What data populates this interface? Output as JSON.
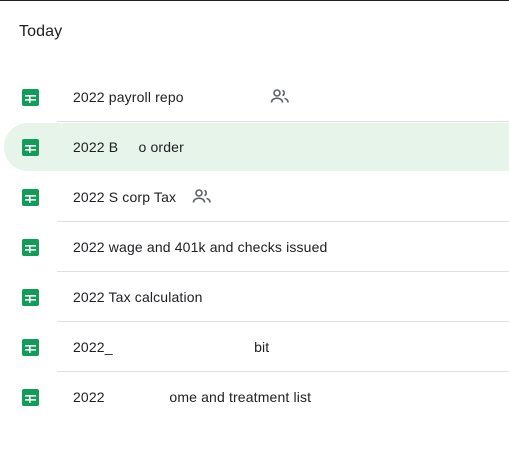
{
  "section": {
    "title": "Today"
  },
  "colors": {
    "sheets_green": "#0f9d58",
    "selected_bg": "#e6f4ea",
    "text": "#202124"
  },
  "files": [
    {
      "name": "2022 payroll repo",
      "icon": "sheets-icon",
      "shared": true,
      "selected": false
    },
    {
      "name": "2022 B     o order",
      "icon": "sheets-icon",
      "shared": false,
      "selected": true
    },
    {
      "name": "2022 S corp Tax",
      "icon": "sheets-icon",
      "shared": true,
      "selected": false
    },
    {
      "name": "2022 wage and 401k and checks issued",
      "icon": "sheets-icon",
      "shared": false,
      "selected": false
    },
    {
      "name": "2022 Tax calculation",
      "icon": "sheets-icon",
      "shared": false,
      "selected": false
    },
    {
      "name": "2022_                                   bit",
      "icon": "sheets-icon",
      "shared": false,
      "selected": false
    },
    {
      "name": "2022                ome and treatment list",
      "icon": "sheets-icon",
      "shared": false,
      "selected": false
    }
  ]
}
